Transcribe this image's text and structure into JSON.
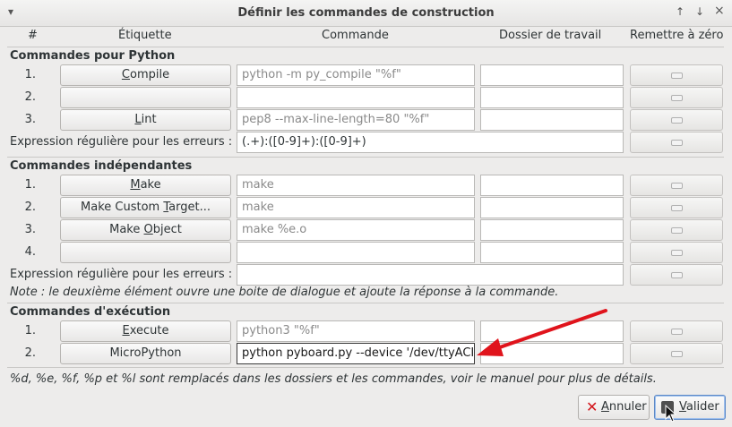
{
  "window": {
    "title": "Définir les commandes de construction",
    "menu_icon": "▾",
    "up_icon": "↑",
    "down_icon": "↓",
    "close_icon": "×"
  },
  "headers": {
    "num": "#",
    "label": "Étiquette",
    "command": "Commande",
    "workdir": "Dossier de travail",
    "reset": "Remettre à zéro"
  },
  "python": {
    "section_title": "Commandes pour Python",
    "rows": [
      {
        "num": "1.",
        "label_pre": "",
        "label_ul": "C",
        "label_post": "ompile",
        "command": "python -m py_compile \"%f\"",
        "workdir": ""
      },
      {
        "num": "2.",
        "label_pre": "",
        "label_ul": "",
        "label_post": "",
        "command": "",
        "workdir": ""
      },
      {
        "num": "3.",
        "label_pre": "",
        "label_ul": "L",
        "label_post": "int",
        "command": "pep8 --max-line-length=80 \"%f\"",
        "workdir": ""
      }
    ],
    "regex_label": "Expression régulière pour les erreurs :",
    "regex_value": "(.+):([0-9]+):([0-9]+)"
  },
  "independent": {
    "section_title": "Commandes indépendantes",
    "rows": [
      {
        "num": "1.",
        "label_pre": "",
        "label_ul": "M",
        "label_post": "ake",
        "command": "make",
        "workdir": ""
      },
      {
        "num": "2.",
        "label_pre": "Make Custom ",
        "label_ul": "T",
        "label_post": "arget...",
        "command": "make",
        "workdir": ""
      },
      {
        "num": "3.",
        "label_pre": "Make ",
        "label_ul": "O",
        "label_post": "bject",
        "command": "make %e.o",
        "workdir": ""
      },
      {
        "num": "4.",
        "label_pre": "",
        "label_ul": "",
        "label_post": "",
        "command": "",
        "workdir": ""
      }
    ],
    "regex_label": "Expression régulière pour les erreurs :",
    "regex_value": "",
    "note": "Note : le deuxième élément ouvre une boite de dialogue et ajoute la réponse à la commande."
  },
  "execution": {
    "section_title": "Commandes d'exécution",
    "rows": [
      {
        "num": "1.",
        "label_pre": "",
        "label_ul": "E",
        "label_post": "xecute",
        "command": "python3 \"%f\"",
        "workdir": ""
      },
      {
        "num": "2.",
        "label_pre": "MicroPython",
        "label_ul": "",
        "label_post": "",
        "command": "python pyboard.py --device '/dev/ttyACI",
        "workdir": ""
      }
    ]
  },
  "footer_note": "%d, %e, %f, %p et %l sont remplacés dans les dossiers et les commandes, voir le manuel pour plus de détails.",
  "buttons": {
    "cancel_ul": "A",
    "cancel_rest": "nnuler",
    "ok_ul": "V",
    "ok_rest": "alider"
  },
  "colors": {
    "arrow": "#e0141c",
    "cancel_icon": "#d3161c"
  }
}
